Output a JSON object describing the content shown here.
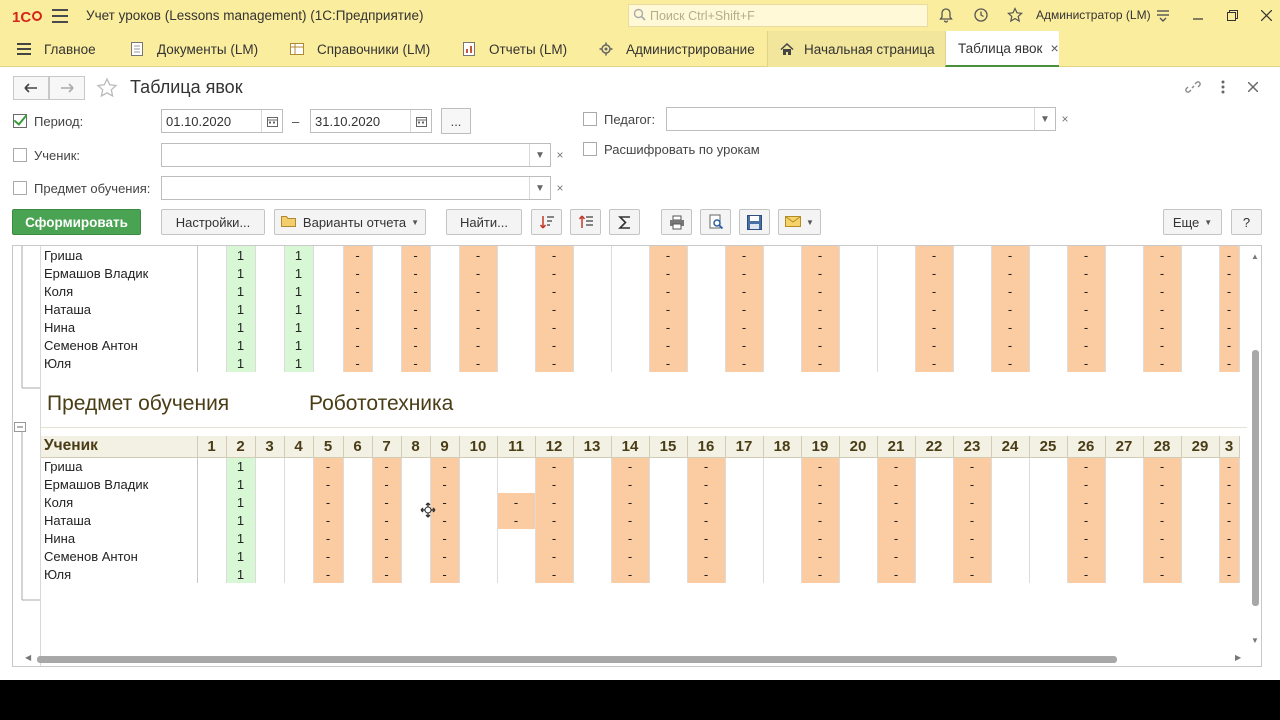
{
  "window": {
    "title": "Учет уроков (Lessons management)  (1С:Предприятие)",
    "search_placeholder": "Поиск Ctrl+Shift+F",
    "user": "Администратор (LM)"
  },
  "sections": [
    {
      "label": "Главное",
      "icon": "menu-icon"
    },
    {
      "label": "Документы (LM)",
      "icon": "document-icon"
    },
    {
      "label": "Справочники (LM)",
      "icon": "catalog-icon"
    },
    {
      "label": "Отчеты (LM)",
      "icon": "report-icon"
    },
    {
      "label": "Администрирование",
      "icon": "gear-icon"
    }
  ],
  "open_tabs": [
    {
      "label": "Начальная страница",
      "icon": "home-icon"
    },
    {
      "label": "Таблица явок",
      "close": "×"
    }
  ],
  "form": {
    "title": "Таблица явок",
    "period_label": "Период:",
    "period_checked": true,
    "date_from": "01.10.2020",
    "date_to": "31.10.2020",
    "dash": "–",
    "dots": "...",
    "teacher_label": "Педагог:",
    "teacher_value": "",
    "student_label": "Ученик:",
    "student_value": "",
    "subject_label": "Предмет обучения:",
    "subject_value": "",
    "decode_label": "Расшифровать по урокам"
  },
  "toolbar": {
    "generate": "Сформировать",
    "settings": "Настройки...",
    "variants": "Варианты отчета",
    "find": "Найти...",
    "more": "Еще",
    "help": "?"
  },
  "report": {
    "group1_rows": [
      {
        "name": "Гриша"
      },
      {
        "name": "Ермашов Владик"
      },
      {
        "name": "Коля"
      },
      {
        "name": "Наташа"
      },
      {
        "name": "Нина"
      },
      {
        "name": "Семенов Антон"
      },
      {
        "name": "Юля"
      }
    ],
    "group1_marks": {
      "2": "1",
      "4": "1"
    },
    "subject_caption": "Предмет обучения",
    "subject_value": "Робототехника",
    "header_label": "Ученик",
    "days": [
      "1",
      "2",
      "3",
      "4",
      "5",
      "6",
      "7",
      "8",
      "9",
      "10",
      "11",
      "12",
      "13",
      "14",
      "15",
      "16",
      "17",
      "18",
      "19",
      "20",
      "21",
      "22",
      "23",
      "24",
      "25",
      "26",
      "27",
      "28",
      "29",
      "3"
    ],
    "group2_rows": [
      {
        "name": "Гриша"
      },
      {
        "name": "Ермашов Владик"
      },
      {
        "name": "Коля"
      },
      {
        "name": "Наташа"
      },
      {
        "name": "Нина"
      },
      {
        "name": "Семенов Антон"
      },
      {
        "name": "Юля"
      }
    ],
    "present_mark": "1",
    "absent_mark": "-"
  },
  "colors": {
    "header_bg": "#fbed9e",
    "present": "#d7f7d5",
    "absent": "#fbcba2",
    "generate_button": "#4aa352"
  }
}
